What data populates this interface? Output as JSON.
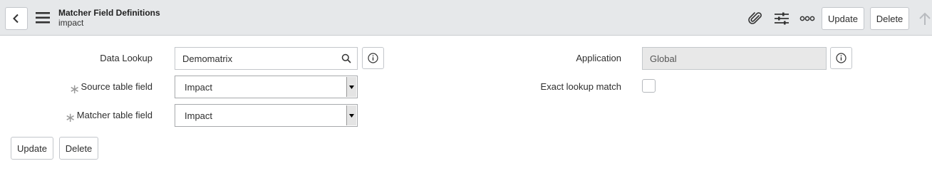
{
  "header": {
    "title": "Matcher Field Definitions",
    "subtitle": "impact",
    "update_label": "Update",
    "delete_label": "Delete",
    "icons": [
      "back-icon",
      "hamburger-menu-icon",
      "attachment-icon",
      "settings-sliders-icon",
      "more-options-icon",
      "scroll-up-arrow-icon"
    ]
  },
  "form": {
    "data_lookup": {
      "label": "Data Lookup",
      "value": "Demomatrix"
    },
    "source_table_field": {
      "label": "Source table field",
      "value": "Impact",
      "required_mark": "∗"
    },
    "matcher_table_field": {
      "label": "Matcher table field",
      "value": "Impact",
      "required_mark": "∗"
    },
    "application": {
      "label": "Application",
      "value": "Global"
    },
    "exact_lookup_match": {
      "label": "Exact lookup match",
      "checked": false
    }
  },
  "footer": {
    "update_label": "Update",
    "delete_label": "Delete"
  },
  "colors": {
    "header_bg": "#e6e8ea",
    "readonly_bg": "#e8e8e8",
    "border": "#c4c7cb"
  }
}
